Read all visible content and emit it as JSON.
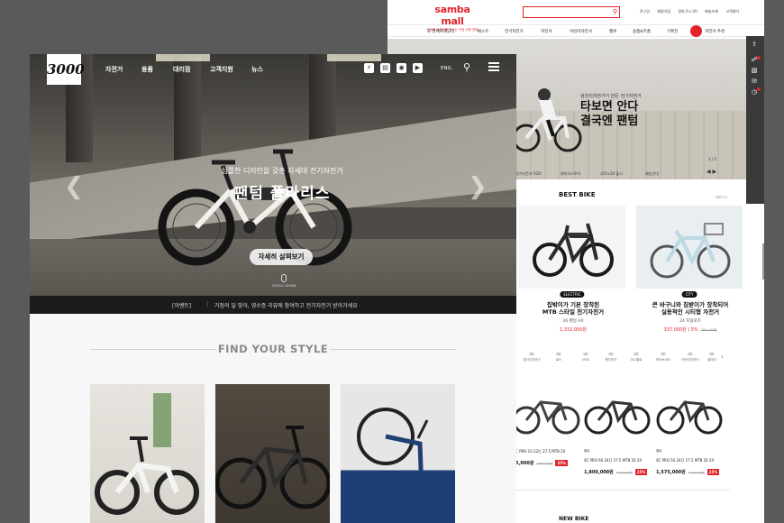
{
  "samba": {
    "logo": "samba mall",
    "logo_sub": "삼바몰 자전거를 만나는 가장 쉬운 방법",
    "util": [
      "로그인",
      "회원가입",
      "장바구니 (0)",
      "배송조회",
      "고객센터"
    ],
    "nav": [
      "전체카테고리",
      "베스트",
      "전기자전거",
      "자전거",
      "어린이자전거",
      "헬로",
      "용품&부품",
      "기획전",
      "자전거 추천"
    ],
    "hero_small": "삼천리자전거가 만든 전기자전거",
    "hero_big_1": "타보면 안다",
    "hero_big_2": "결국엔 팬텀",
    "hero_page": "1 / 5",
    "hero_tabs": [
      "전기자전거 O2O",
      "레이크스토어",
      "고르노50 출시",
      "배송안내"
    ],
    "best_title": "BEST BIKE",
    "more": "더보기 >",
    "cards": [
      {
        "tag": "ELECTRIC",
        "title1": "집밖이가 기본 장착된",
        "title2": "MTB 스타일 전기자전거",
        "sub": "26 팬텀 HX",
        "price": "1,332,000원"
      },
      {
        "tag": "CITY",
        "title1": "큰 바구니와 짐받이가 장착되어",
        "title2": "실용적인 시티형 자전거",
        "sub": "24 프림로즈",
        "price": "337,000원 | 5%",
        "orig": "355,000원"
      }
    ],
    "cats": [
      "접이식자전거",
      "로드",
      "MTB",
      "펫자전거",
      "미니벨로",
      "하이브리드",
      "어린이자전거",
      "클래식"
    ],
    "products": [
      {
        "brand": "",
        "name": "C PRO 10 22단 27.5 MTB 20",
        "price": "5,000원",
        "orig": "1,860,000원",
        "dc": "25%"
      },
      {
        "brand": "첼로",
        "name": "XC PRO 60 24단 27.5 MTB 20 24",
        "price": "1,800,000원",
        "orig": "2,400,000원",
        "dc": "25%"
      },
      {
        "brand": "첼로",
        "name": "XC PRO 50 24단 27.5 MTB 20 24",
        "price": "1,575,000원",
        "orig": "2,100,000원",
        "dc": "25%"
      }
    ],
    "foot": "NEW BIKE"
  },
  "main": {
    "logo": "3000",
    "nav": [
      "자전거",
      "용품",
      "대리점",
      "고객지원",
      "뉴스"
    ],
    "eng": "ENG",
    "hero_sub": "심플한 디자인을 갖춘 차세대 전기자전거",
    "hero_title": "팬텀 폴라리스",
    "hero_btn": "자세히 살펴보기",
    "scroll": "SCROLL DOWN",
    "event_tag": "[이벤트]",
    "event_sep": "|",
    "event_text": "가정의 달 맞이, 영수증 리뷰에 참여하고 전기자전거 받아가세요",
    "section_title": "FIND YOUR STYLE"
  },
  "colors": {
    "brand_red": "#e2232a",
    "dark": "#1c1c1c"
  }
}
